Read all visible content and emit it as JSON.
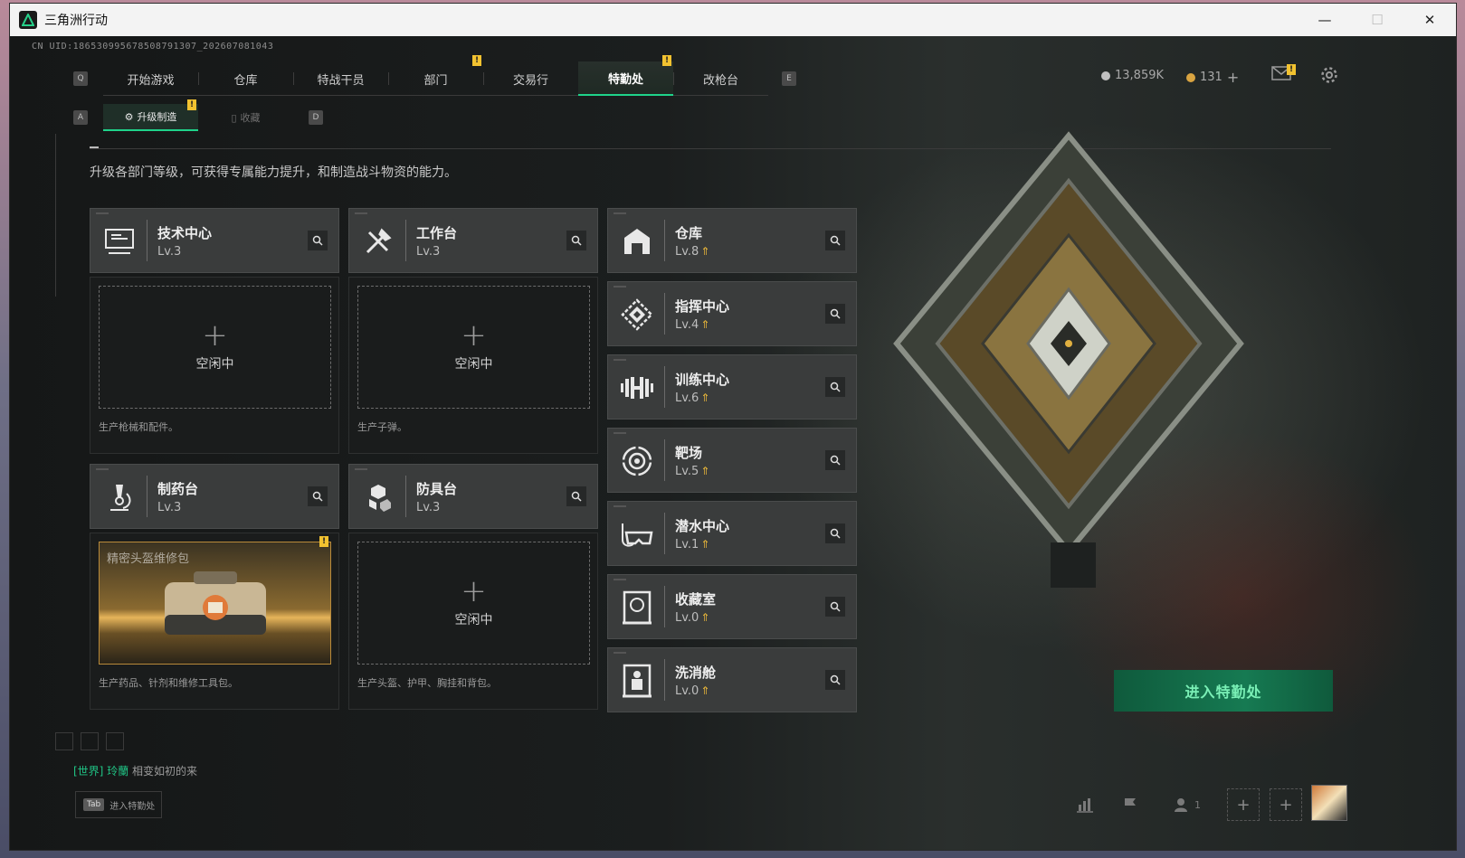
{
  "window": {
    "title": "三角洲行动",
    "minimize": "—",
    "maximize": "☐",
    "close": "✕"
  },
  "uid": "CN UID:186530995678508791307_202607081043",
  "keys": {
    "q": "Q",
    "e": "E",
    "a": "A",
    "d": "D"
  },
  "main_tabs": [
    {
      "label": "开始游戏"
    },
    {
      "label": "仓库"
    },
    {
      "label": "特战干员"
    },
    {
      "label": "部门"
    },
    {
      "label": "交易行"
    },
    {
      "label": "特勤处"
    },
    {
      "label": "改枪台"
    }
  ],
  "badge": "!",
  "currency": {
    "silver": "13,859K",
    "gold": "131",
    "plus": "+"
  },
  "sub_tabs": [
    {
      "label": "升级制造"
    },
    {
      "label": "收藏"
    }
  ],
  "description": "升级各部门等级，可获得专属能力提升，和制造战斗物资的能力。",
  "left_departments": [
    {
      "name": "技术中心",
      "level": "Lv.3",
      "icon": "monitor-icon",
      "slot_state": "空闲中",
      "slot_desc": "生产枪械和配件。"
    },
    {
      "name": "工作台",
      "level": "Lv.3",
      "icon": "tools-icon",
      "slot_state": "空闲中",
      "slot_desc": "生产子弹。"
    },
    {
      "name": "制药台",
      "level": "Lv.3",
      "icon": "microscope-icon",
      "product": "精密头盔维修包",
      "slot_desc": "生产药品、针剂和维修工具包。"
    },
    {
      "name": "防具台",
      "level": "Lv.3",
      "icon": "armor-icon",
      "slot_state": "空闲中",
      "slot_desc": "生产头盔、护甲、胸挂和背包。"
    }
  ],
  "right_departments": [
    {
      "name": "仓库",
      "level": "Lv.8",
      "icon": "warehouse-icon"
    },
    {
      "name": "指挥中心",
      "level": "Lv.4",
      "icon": "command-icon"
    },
    {
      "name": "训练中心",
      "level": "Lv.6",
      "icon": "dumbbell-icon"
    },
    {
      "name": "靶场",
      "level": "Lv.5",
      "icon": "target-icon"
    },
    {
      "name": "潜水中心",
      "level": "Lv.1",
      "icon": "diving-mask-icon"
    },
    {
      "name": "收藏室",
      "level": "Lv.0",
      "icon": "collection-icon"
    },
    {
      "name": "洗消舱",
      "level": "Lv.0",
      "icon": "decontamination-icon"
    }
  ],
  "level_up_glyph": "⇑",
  "plus_glyph": "+",
  "enter_button": "进入特勤处",
  "chat": {
    "channel": "[世界]",
    "user": "玲蘭",
    "message": "相变如初的来"
  },
  "tab_hint": {
    "key": "Tab",
    "label": "进入特勤处"
  },
  "bottom": {
    "friends_count": "1",
    "plus": "+"
  },
  "colors": {
    "accent": "#1fd38a",
    "warning": "#f2c230",
    "level_up": "#e8b63a"
  }
}
